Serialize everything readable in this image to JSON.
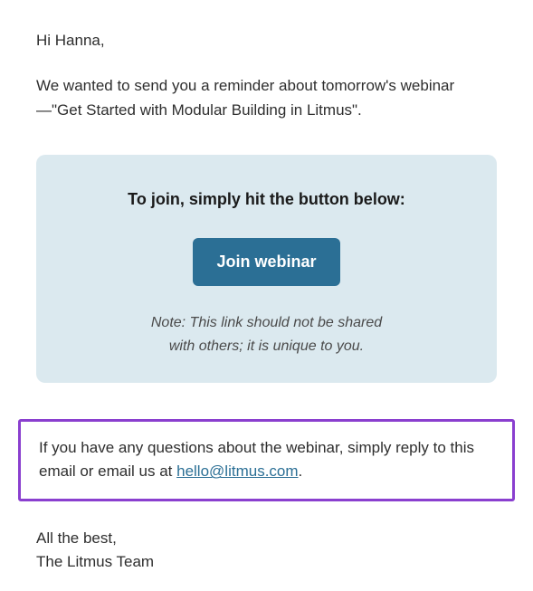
{
  "greeting": "Hi Hanna,",
  "intro": "We wanted to send you a reminder about tomorrow's webinar—\"Get Started with Modular Building in Litmus\".",
  "cta": {
    "heading": "To join, simply hit the button below:",
    "button_label": "Join webinar",
    "note_line1": "Note: This link should not be shared",
    "note_line2": "with others; it is unique to you."
  },
  "questions": {
    "text_before": "If you have any questions about the webinar, simply reply to this email or email us at ",
    "email": "hello@litmus.com",
    "text_after": "."
  },
  "signoff": {
    "line1": "All the best,",
    "line2": "The Litmus Team"
  }
}
